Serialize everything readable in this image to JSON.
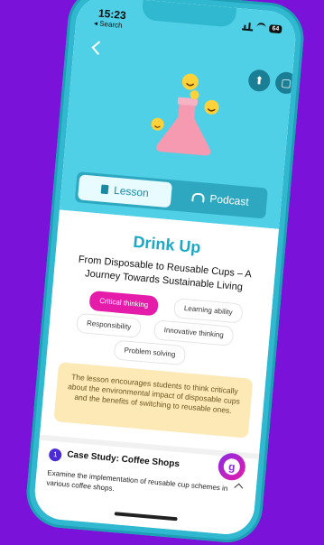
{
  "status": {
    "time": "15:23",
    "back_label": "◂ Search",
    "battery": "64"
  },
  "header": {
    "back_icon": "chevron-left-icon",
    "actions": [
      "upload-icon",
      "copy-icon"
    ]
  },
  "tabs": [
    {
      "label": "Lesson",
      "icon": "book-icon",
      "active": true
    },
    {
      "label": "Podcast",
      "icon": "headphones-icon",
      "active": false
    }
  ],
  "lesson": {
    "title": "Drink Up",
    "subtitle": "From Disposable to Reusable Cups – A Journey Towards Sustainable Living",
    "skills": [
      {
        "label": "Critical thinking",
        "active": true
      },
      {
        "label": "Learning ability",
        "active": false
      },
      {
        "label": "Responsibility",
        "active": false
      },
      {
        "label": "Innovative thinking",
        "active": false
      },
      {
        "label": "Problem solving",
        "active": false
      }
    ],
    "description": "The lesson encourages students to think critically about the environmental impact of disposable cups and the benefits of switching to reusable ones."
  },
  "case_study": {
    "number": "1",
    "title": "Case Study: Coffee Shops",
    "text": "Examine the implementation of reusable cup schemes in various coffee shops."
  },
  "colors": {
    "background": "#7a12d9",
    "hero": "#4fd0e6",
    "accent": "#1aa9c7",
    "chip_active": "#e51caa",
    "description_bg": "#fde9b5"
  },
  "fab": {
    "label": "g"
  }
}
